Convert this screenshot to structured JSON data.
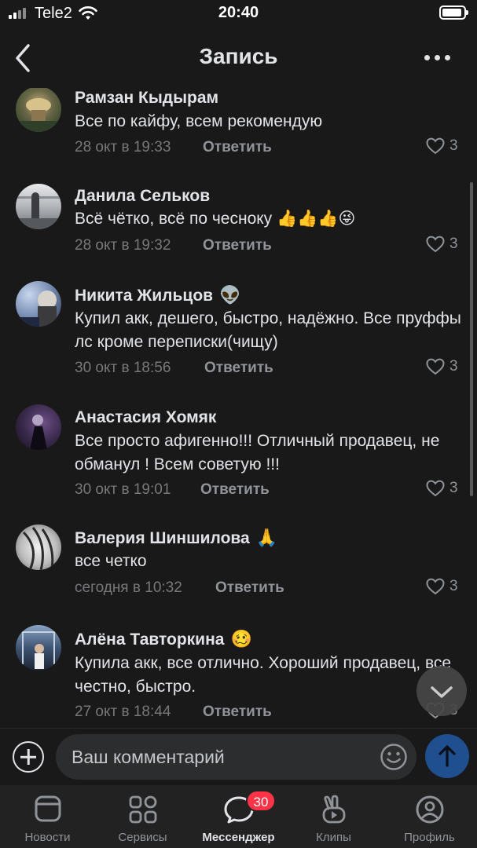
{
  "status_bar": {
    "carrier": "Tele2",
    "time": "20:40"
  },
  "header": {
    "title": "Запись",
    "back_icon": "chevron-left-icon",
    "more_icon": "more-horizontal-icon"
  },
  "comments": [
    {
      "author": "Рамзан Кыдырам",
      "author_emoji": "",
      "text": "Все по кайфу, всем рекомендую",
      "date": "28 окт в 19:33",
      "reply_label": "Ответить",
      "likes": "3"
    },
    {
      "author": "Данила Сельков",
      "author_emoji": "",
      "text": "Всё чётко, всё по чесноку 👍👍👍😜",
      "date": "28 окт в 19:32",
      "reply_label": "Ответить",
      "likes": "3"
    },
    {
      "author": "Никита Жильцов",
      "author_emoji": "👽",
      "text": "Купил акк, дешего, быстро, надёжно. Все пруффы лс кроме переписки(чищу)",
      "date": "30 окт в 18:56",
      "reply_label": "Ответить",
      "likes": "3"
    },
    {
      "author": "Анастасия Хомяк",
      "author_emoji": "",
      "text": "Все просто афигенно!!! Отличный продавец, не обманул ! Всем советую !!!",
      "date": "30 окт в 19:01",
      "reply_label": "Ответить",
      "likes": "3"
    },
    {
      "author": "Валерия Шиншилова",
      "author_emoji": "🙏",
      "text": "все четко",
      "date": "сегодня в 10:32",
      "reply_label": "Ответить",
      "likes": "3"
    },
    {
      "author": "Алёна Тавторкина",
      "author_emoji": "🥴",
      "text": "Купила акк, все отлично. Хороший продавец, все честно, быстро.",
      "date": "27 окт в 18:44",
      "reply_label": "Ответить",
      "likes": "3"
    }
  ],
  "composer": {
    "placeholder": "Ваш комментарий"
  },
  "tabs": [
    {
      "label": "Новости",
      "icon": "news-icon"
    },
    {
      "label": "Сервисы",
      "icon": "services-grid-icon"
    },
    {
      "label": "Мессенджер",
      "icon": "messenger-icon",
      "active": true,
      "badge": "30"
    },
    {
      "label": "Клипы",
      "icon": "clips-icon"
    },
    {
      "label": "Профиль",
      "icon": "profile-icon"
    }
  ],
  "colors": {
    "background": "#19191a",
    "text": "#e1e3e6",
    "secondary_text": "#76787a",
    "accent": "#1f4f8f",
    "badge": "#ff3347"
  }
}
